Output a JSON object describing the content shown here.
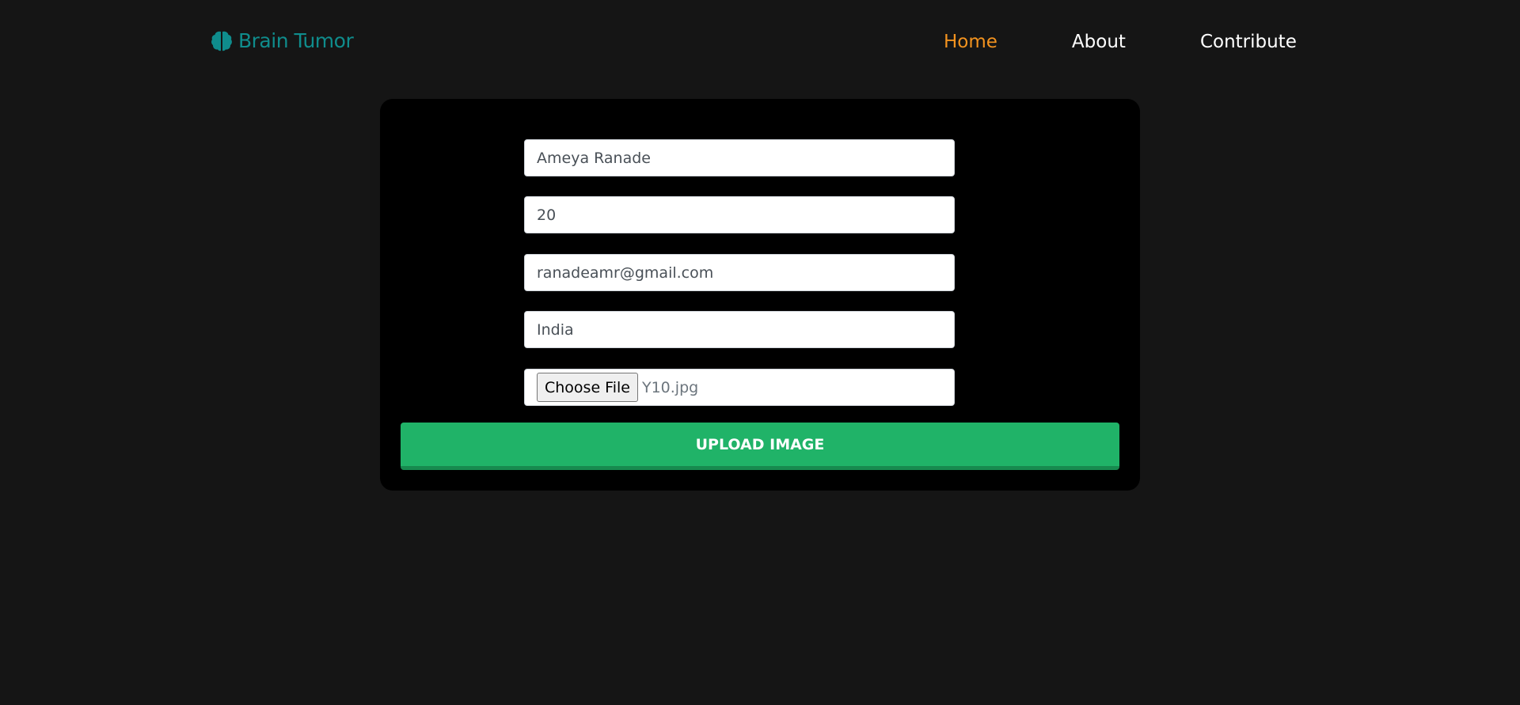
{
  "header": {
    "logo_text": "Brain Tumor",
    "logo_icon": "brain-icon",
    "nav_links": [
      {
        "label": "Home",
        "active": true
      },
      {
        "label": "About",
        "active": false
      },
      {
        "label": "Contribute",
        "active": false
      }
    ]
  },
  "form": {
    "name_value": "Ameya Ranade",
    "age_value": "20",
    "email_value": "ranadeamr@gmail.com",
    "country_value": "India",
    "file_button_label": "Choose File",
    "file_name": "Y10.jpg",
    "submit_label": "UPLOAD IMAGE"
  },
  "colors": {
    "background": "#151515",
    "card": "#000000",
    "brand": "#0f8c8c",
    "active_link": "#f3931f",
    "submit_button": "#20b368"
  }
}
